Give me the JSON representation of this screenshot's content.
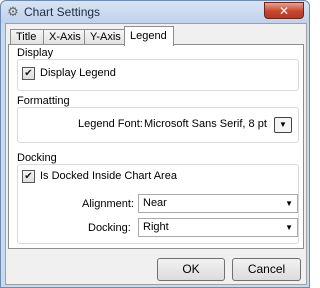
{
  "window": {
    "title": "Chart Settings",
    "close_label": "✕"
  },
  "tabs": [
    "Title",
    "X-Axis",
    "Y-Axis",
    "Legend"
  ],
  "display": {
    "group_label": "Display",
    "display_legend_label": "Display Legend",
    "display_legend_checked": true
  },
  "formatting": {
    "group_label": "Formatting",
    "legend_font_label": "Legend Font:",
    "legend_font_value": "Microsoft Sans Serif, 8 pt"
  },
  "docking": {
    "group_label": "Docking",
    "docked_inside_label": "Is Docked Inside Chart Area",
    "docked_inside_checked": true,
    "alignment_label": "Alignment:",
    "alignment_value": "Near",
    "docking_label": "Docking:",
    "docking_value": "Right"
  },
  "buttons": {
    "ok": "OK",
    "cancel": "Cancel"
  }
}
